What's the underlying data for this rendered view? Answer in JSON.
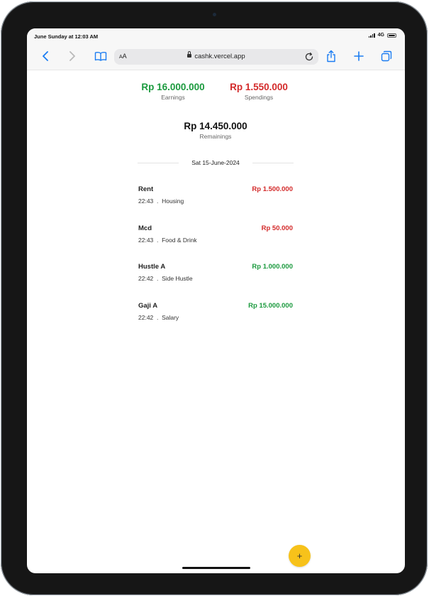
{
  "status_bar": {
    "time": "June Sunday at 12:03 AM",
    "network": "4G"
  },
  "browser": {
    "text_size_label": "AA",
    "url": "cashk.vercel.app",
    "icons": [
      "back-icon",
      "forward-icon",
      "bookmarks-icon",
      "lock-icon",
      "reload-icon",
      "share-icon",
      "new-tab-icon",
      "tabs-icon"
    ]
  },
  "summary": {
    "earnings_amount": "Rp 16.000.000",
    "earnings_label": "Earnings",
    "spendings_amount": "Rp 1.550.000",
    "spendings_label": "Spendings",
    "remainings_amount": "Rp 14.450.000",
    "remainings_label": "Remainings"
  },
  "day_group": {
    "date": "Sat 15-June-2024",
    "transactions": [
      {
        "name": "Rent",
        "amount": "Rp 1.500.000",
        "type": "spending",
        "meta": "22:43  .  Housing"
      },
      {
        "name": "Mcd",
        "amount": "Rp 50.000",
        "type": "spending",
        "meta": "22:43  .  Food & Drink"
      },
      {
        "name": "Hustle A",
        "amount": "Rp 1.000.000",
        "type": "earning",
        "meta": "22:42  .  Side Hustle"
      },
      {
        "name": "Gaji A",
        "amount": "Rp 15.000.000",
        "type": "earning",
        "meta": "22:42  .  Salary"
      }
    ]
  },
  "fab": {
    "label": "+"
  },
  "colors": {
    "earning": "#1b9a3e",
    "spending": "#d32a2a",
    "fab": "#f7c21a",
    "accent": "#1a7cf2"
  }
}
